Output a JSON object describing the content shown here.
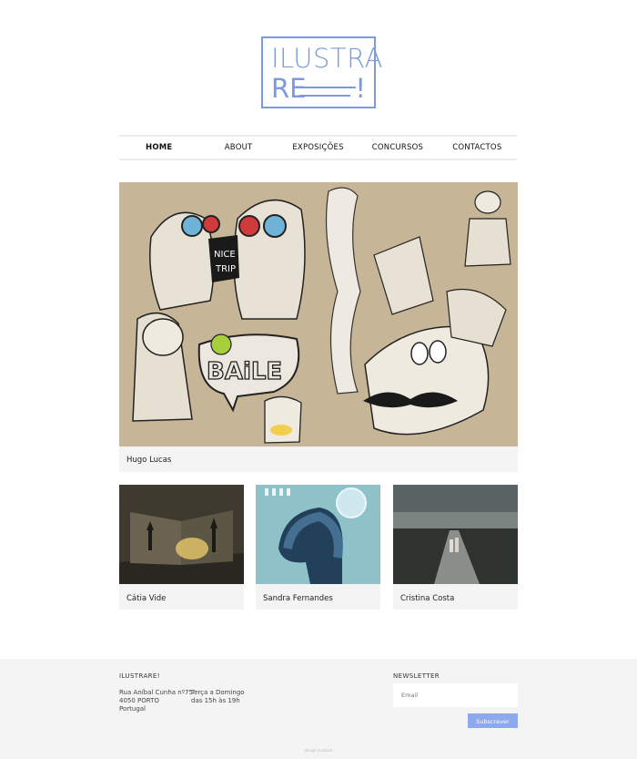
{
  "logo": {
    "line1": "ILUSTRA",
    "line2": "RE",
    "mark": "!"
  },
  "nav": {
    "items": [
      {
        "label": "HOME",
        "active": true
      },
      {
        "label": "ABOUT",
        "active": false
      },
      {
        "label": "EXPOSIÇÕES",
        "active": false
      },
      {
        "label": "CONCURSOS",
        "active": false
      },
      {
        "label": "CONTACTOS",
        "active": false
      }
    ]
  },
  "hero": {
    "caption": "Hugo Lucas",
    "image": "illustration-baile"
  },
  "cards": [
    {
      "caption": "Cátia Vide",
      "image": "illustration-popup-book"
    },
    {
      "caption": "Sandra Fernandes",
      "image": "illustration-blue-head"
    },
    {
      "caption": "Cristina Costa",
      "image": "photo-road-landscape"
    }
  ],
  "footer": {
    "brand": "ILUSTRARE!",
    "address": [
      "Rua Aníbal Cunha nº75",
      "4050 PORTO",
      "Portugal"
    ],
    "hours": [
      "Terça a Domingo",
      "das 15h às 19h"
    ],
    "newsletter_title": "NEWSLETTER",
    "email_placeholder": "Email",
    "subscribe_label": "Subscrever",
    "credit": "design ilustrare"
  },
  "colors": {
    "accent": "#7b9ae0",
    "button": "#8ea8ec",
    "footer_bg": "#f4f4f4"
  }
}
